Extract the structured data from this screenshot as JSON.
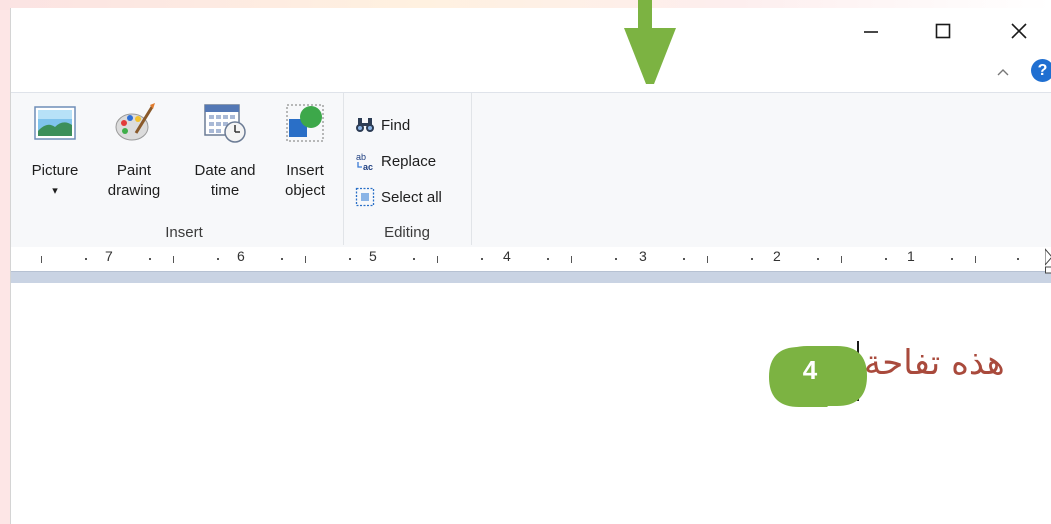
{
  "window_controls": {
    "minimize": "minimize",
    "maximize": "maximize",
    "close": "close"
  },
  "ribbon": {
    "insert_group": {
      "label": "Insert",
      "buttons": [
        {
          "line1": "Picture",
          "line2": "▾",
          "icon": "picture-icon"
        },
        {
          "line1": "Paint",
          "line2": "drawing",
          "icon": "paint-drawing-icon"
        },
        {
          "line1": "Date and",
          "line2": "time",
          "icon": "calendar-clock-icon"
        },
        {
          "line1": "Insert",
          "line2": "object",
          "icon": "insert-object-icon"
        }
      ]
    },
    "editing_group": {
      "label": "Editing",
      "find": "Find",
      "replace": "Replace",
      "select_all": "Select all"
    },
    "help_symbol": "?"
  },
  "ruler": {
    "numbers": [
      "7",
      "6",
      "5",
      "4",
      "3",
      "2",
      "1"
    ]
  },
  "document": {
    "text": "هذه تفاحة"
  },
  "callout": {
    "number": "4",
    "color": "#7cb342"
  },
  "colors": {
    "ribbon_bg": "#f7f8fa",
    "ruler_bg": "#c9d3e3",
    "text_color": "#a94a3c",
    "arrow_color": "#7cb342",
    "help_blue": "#1f6fd1"
  }
}
